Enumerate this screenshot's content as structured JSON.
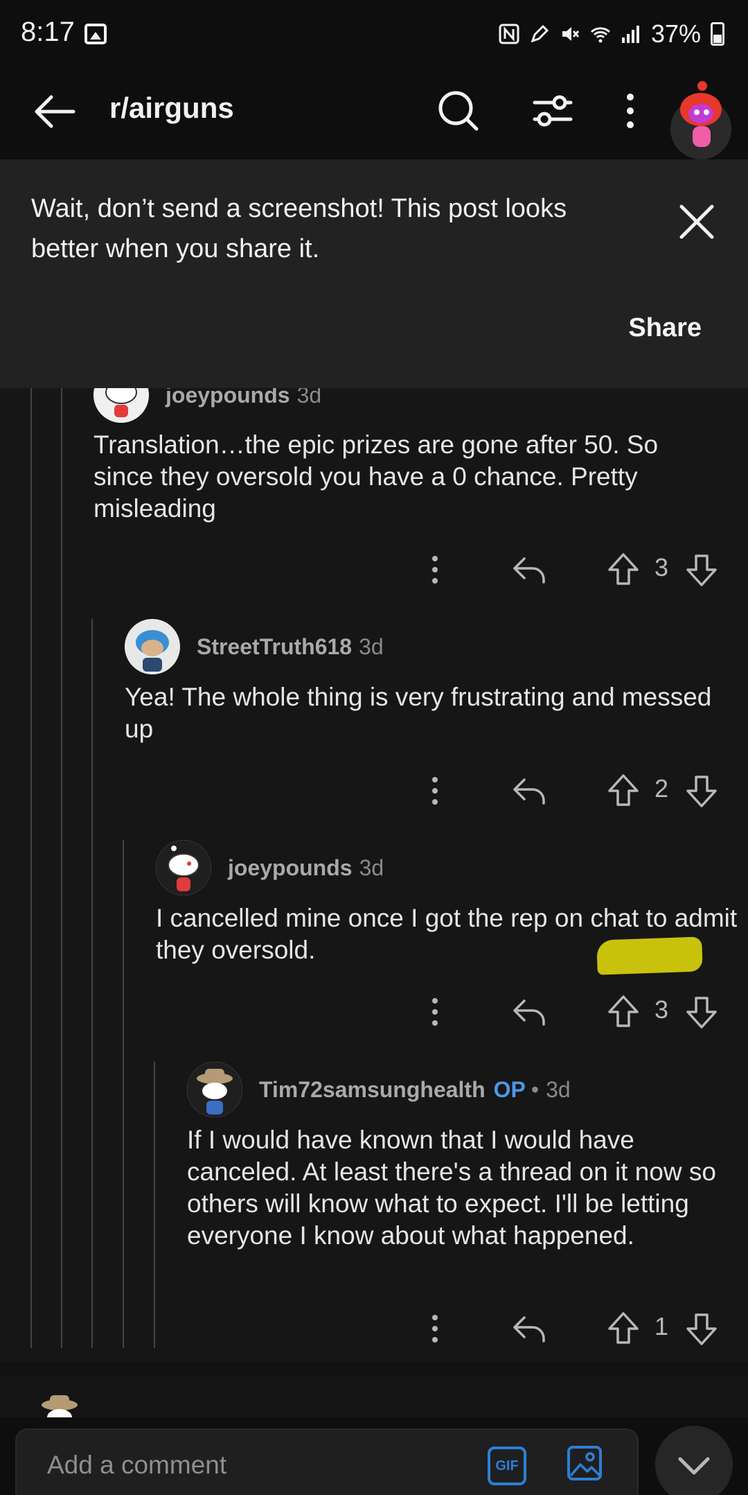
{
  "status_bar": {
    "time": "8:17",
    "battery": "37%"
  },
  "header": {
    "subreddit": "r/airguns"
  },
  "banner": {
    "message": "Wait, don’t send a screenshot! This post looks better when you share it.",
    "share_label": "Share"
  },
  "comments": [
    {
      "user": "joeypounds",
      "time": "3d",
      "body": "Translation…the epic prizes are gone after 50. So since they oversold you have a 0 chance. Pretty misleading",
      "votes": "3"
    },
    {
      "user": "StreetTruth618",
      "time": "3d",
      "body": "Yea! The whole thing is very frustrating and messed up",
      "votes": "2"
    },
    {
      "user": "joeypounds",
      "time": "3d",
      "body": "I cancelled mine once I got the rep on chat to admit they oversold.",
      "votes": "3"
    },
    {
      "user": "Tim72samsunghealth",
      "op_badge": "OP",
      "separator": "•",
      "time": "3d",
      "body": "If I would have known that I would have canceled. At least there's a thread on it now so others will know what to expect. I'll be letting everyone I know about what happened.",
      "votes": "1"
    }
  ],
  "comment_input": {
    "placeholder": "Add a comment",
    "gif_label": "GIF"
  },
  "colors": {
    "background": "#121212",
    "banner": "#222222",
    "op_blue": "#4f96e6",
    "highlight": "#c9c20d"
  }
}
